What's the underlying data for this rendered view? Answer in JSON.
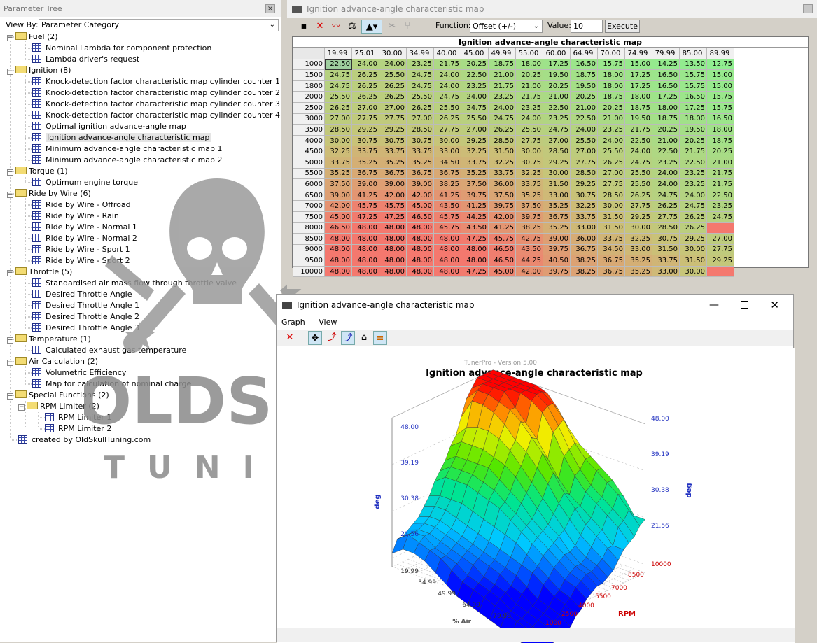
{
  "tree": {
    "title": "Parameter Tree",
    "close_glyph": "×",
    "view_by_label": "View By:",
    "view_by_value": "Parameter Category",
    "nodes": [
      {
        "label": "Fuel (2)",
        "type": "folder",
        "depth": 0
      },
      {
        "label": "Nominal Lambda for component protection",
        "type": "item",
        "depth": 1
      },
      {
        "label": "Lambda driver's request",
        "type": "item",
        "depth": 1
      },
      {
        "label": "Ignition (8)",
        "type": "folder",
        "depth": 0
      },
      {
        "label": "Knock-detection factor characteristic map cylinder counter 1",
        "type": "item",
        "depth": 1
      },
      {
        "label": "Knock-detection factor characteristic map cylinder counter 2",
        "type": "item",
        "depth": 1
      },
      {
        "label": "Knock-detection factor characteristic map cylinder counter 3",
        "type": "item",
        "depth": 1
      },
      {
        "label": "Knock-detection factor characteristic map cylinder counter 4",
        "type": "item",
        "depth": 1
      },
      {
        "label": "Optimal ignition advance-angle map",
        "type": "item",
        "depth": 1
      },
      {
        "label": "Ignition advance-angle characteristic map",
        "type": "item",
        "depth": 1,
        "selected": true
      },
      {
        "label": "Minimum advance-angle characteristic map 1",
        "type": "item",
        "depth": 1
      },
      {
        "label": "Minimum advance-angle characteristic map 2",
        "type": "item",
        "depth": 1
      },
      {
        "label": "Torque (1)",
        "type": "folder",
        "depth": 0
      },
      {
        "label": "Optimum engine torque",
        "type": "item",
        "depth": 1
      },
      {
        "label": "Ride by Wire (6)",
        "type": "folder",
        "depth": 0
      },
      {
        "label": "Ride by Wire - Offroad",
        "type": "item",
        "depth": 1
      },
      {
        "label": "Ride by Wire - Rain",
        "type": "item",
        "depth": 1
      },
      {
        "label": "Ride by Wire - Normal 1",
        "type": "item",
        "depth": 1
      },
      {
        "label": "Ride by Wire - Normal 2",
        "type": "item",
        "depth": 1
      },
      {
        "label": "Ride by Wire - Sport 1",
        "type": "item",
        "depth": 1
      },
      {
        "label": "Ride by Wire - Sport 2",
        "type": "item",
        "depth": 1
      },
      {
        "label": "Throttle (5)",
        "type": "folder",
        "depth": 0
      },
      {
        "label": "Standardised air mass flow through throttle valve",
        "type": "item",
        "depth": 1
      },
      {
        "label": "Desired Throttle Angle",
        "type": "item",
        "depth": 1
      },
      {
        "label": "Desired Throttle Angle 1",
        "type": "item",
        "depth": 1
      },
      {
        "label": "Desired Throttle Angle 2",
        "type": "item",
        "depth": 1
      },
      {
        "label": "Desired Throttle Angle 3",
        "type": "item",
        "depth": 1
      },
      {
        "label": "Temperature (1)",
        "type": "folder",
        "depth": 0
      },
      {
        "label": "Calculated exhaust gas temperature",
        "type": "item",
        "depth": 1
      },
      {
        "label": "Air Calculation (2)",
        "type": "folder",
        "depth": 0
      },
      {
        "label": "Volumetric Efficiency",
        "type": "item",
        "depth": 1
      },
      {
        "label": "Map for calculation of nominal charge",
        "type": "item",
        "depth": 1
      },
      {
        "label": "Special Functions (2)",
        "type": "folder",
        "depth": 0
      },
      {
        "label": "RPM Limiter (2)",
        "type": "folder",
        "depth": 1
      },
      {
        "label": "RPM Limiter 1",
        "type": "item",
        "depth": 2
      },
      {
        "label": "RPM Limiter 2",
        "type": "item",
        "depth": 2
      },
      {
        "label": "created by OldSkullTuning.com",
        "type": "item",
        "depth": 0
      }
    ]
  },
  "watermark": {
    "line1": "OLDSKULL",
    "line2": "TUNING"
  },
  "map_window": {
    "title": "Ignition advance-angle characteristic map",
    "toolbar": {
      "function_label": "Function:",
      "function_value": "Offset (+/-)",
      "value_label": "Value:",
      "value_input": "10",
      "execute_label": "Execute"
    },
    "table_title": "Ignition advance-angle characteristic map",
    "col_headers": [
      "19.99",
      "25.01",
      "30.00",
      "34.99",
      "40.00",
      "45.00",
      "49.99",
      "55.00",
      "60.00",
      "64.99",
      "70.00",
      "74.99",
      "79.99",
      "85.00",
      "89.99"
    ],
    "row_headers": [
      "1000",
      "1500",
      "1800",
      "2000",
      "2500",
      "3000",
      "3500",
      "4000",
      "4500",
      "5000",
      "5500",
      "6000",
      "6500",
      "7000",
      "7500",
      "8000",
      "8500",
      "9000",
      "9500",
      "10000"
    ],
    "cells": [
      [
        "22.50",
        "24.00",
        "24.00",
        "23.25",
        "21.75",
        "20.25",
        "18.75",
        "18.00",
        "17.25",
        "16.50",
        "15.75",
        "15.00",
        "14.25",
        "13.50",
        "12.75"
      ],
      [
        "24.75",
        "26.25",
        "25.50",
        "24.75",
        "24.00",
        "22.50",
        "21.00",
        "20.25",
        "19.50",
        "18.75",
        "18.00",
        "17.25",
        "16.50",
        "15.75",
        "15.00"
      ],
      [
        "24.75",
        "26.25",
        "26.25",
        "24.75",
        "24.00",
        "23.25",
        "21.75",
        "21.00",
        "20.25",
        "19.50",
        "18.00",
        "17.25",
        "16.50",
        "15.75",
        "15.00"
      ],
      [
        "25.50",
        "26.25",
        "26.25",
        "25.50",
        "24.75",
        "24.00",
        "23.25",
        "21.75",
        "21.00",
        "20.25",
        "18.75",
        "18.00",
        "17.25",
        "16.50",
        "15.75"
      ],
      [
        "26.25",
        "27.00",
        "27.00",
        "26.25",
        "25.50",
        "24.75",
        "24.00",
        "23.25",
        "22.50",
        "21.00",
        "20.25",
        "18.75",
        "18.00",
        "17.25",
        "15.75"
      ],
      [
        "27.00",
        "27.75",
        "27.75",
        "27.00",
        "26.25",
        "25.50",
        "24.75",
        "24.00",
        "23.25",
        "22.50",
        "21.00",
        "19.50",
        "18.75",
        "18.00",
        "16.50"
      ],
      [
        "28.50",
        "29.25",
        "29.25",
        "28.50",
        "27.75",
        "27.00",
        "26.25",
        "25.50",
        "24.75",
        "24.00",
        "23.25",
        "21.75",
        "20.25",
        "19.50",
        "18.00"
      ],
      [
        "30.00",
        "30.75",
        "30.75",
        "30.75",
        "30.00",
        "29.25",
        "28.50",
        "27.75",
        "27.00",
        "25.50",
        "24.00",
        "22.50",
        "21.00",
        "20.25",
        "18.75"
      ],
      [
        "32.25",
        "33.75",
        "33.75",
        "33.75",
        "33.00",
        "32.25",
        "31.50",
        "30.00",
        "28.50",
        "27.00",
        "25.50",
        "24.00",
        "22.50",
        "21.75",
        "20.25"
      ],
      [
        "33.75",
        "35.25",
        "35.25",
        "35.25",
        "34.50",
        "33.75",
        "32.25",
        "30.75",
        "29.25",
        "27.75",
        "26.25",
        "24.75",
        "23.25",
        "22.50",
        "21.00"
      ],
      [
        "35.25",
        "36.75",
        "36.75",
        "36.75",
        "36.75",
        "35.25",
        "33.75",
        "32.25",
        "30.00",
        "28.50",
        "27.00",
        "25.50",
        "24.00",
        "23.25",
        "21.75"
      ],
      [
        "37.50",
        "39.00",
        "39.00",
        "39.00",
        "38.25",
        "37.50",
        "36.00",
        "33.75",
        "31.50",
        "29.25",
        "27.75",
        "25.50",
        "24.00",
        "23.25",
        "21.75"
      ],
      [
        "39.00",
        "41.25",
        "42.00",
        "42.00",
        "41.25",
        "39.75",
        "37.50",
        "35.25",
        "33.00",
        "30.75",
        "28.50",
        "26.25",
        "24.75",
        "24.00",
        "22.50"
      ],
      [
        "42.00",
        "45.75",
        "45.75",
        "45.00",
        "43.50",
        "41.25",
        "39.75",
        "37.50",
        "35.25",
        "32.25",
        "30.00",
        "27.75",
        "26.25",
        "24.75",
        "23.25"
      ],
      [
        "45.00",
        "47.25",
        "47.25",
        "46.50",
        "45.75",
        "44.25",
        "42.00",
        "39.75",
        "36.75",
        "33.75",
        "31.50",
        "29.25",
        "27.75",
        "26.25",
        "24.75"
      ],
      [
        "46.50",
        "48.00",
        "48.00",
        "48.00",
        "45.75",
        "43.50",
        "41.25",
        "38.25",
        "35.25",
        "33.00",
        "31.50",
        "30.00",
        "28.50",
        "26.25"
      ],
      [
        "48.00",
        "48.00",
        "48.00",
        "48.00",
        "48.00",
        "47.25",
        "45.75",
        "42.75",
        "39.00",
        "36.00",
        "33.75",
        "32.25",
        "30.75",
        "29.25",
        "27.00"
      ],
      [
        "48.00",
        "48.00",
        "48.00",
        "48.00",
        "48.00",
        "48.00",
        "46.50",
        "43.50",
        "39.75",
        "36.75",
        "34.50",
        "33.00",
        "31.50",
        "30.00",
        "27.75"
      ],
      [
        "48.00",
        "48.00",
        "48.00",
        "48.00",
        "48.00",
        "48.00",
        "46.50",
        "44.25",
        "40.50",
        "38.25",
        "36.75",
        "35.25",
        "33.75",
        "31.50",
        "29.25"
      ],
      [
        "48.00",
        "48.00",
        "48.00",
        "48.00",
        "48.00",
        "47.25",
        "45.00",
        "42.00",
        "39.75",
        "38.25",
        "36.75",
        "35.25",
        "33.00",
        "30.00"
      ]
    ],
    "color_min": 12.75,
    "color_max": 48.0
  },
  "graph_window": {
    "title": "Ignition advance-angle characteristic map",
    "menu": [
      "Graph",
      "View"
    ],
    "version_text": "TunerPro - Version 5.00",
    "chart_title": "Ignition advance-angle characteristic map",
    "z_label": "deg",
    "z_ticks": [
      "48.00",
      "39.19",
      "30.38",
      "21.56"
    ],
    "z_ticks_right": [
      "48.00",
      "39.19",
      "30.38",
      "21.56"
    ],
    "air_label": "% Air",
    "air_ticks": [
      "19.99",
      "34.99",
      "49.99",
      "64.99",
      "79.99"
    ],
    "rpm_label": "RPM",
    "rpm_ticks": [
      "1000",
      "2500",
      "4000",
      "5500",
      "7000",
      "8500",
      "10000"
    ],
    "colors": {
      "min": "#0000ff",
      "max": "#ff0000"
    }
  }
}
